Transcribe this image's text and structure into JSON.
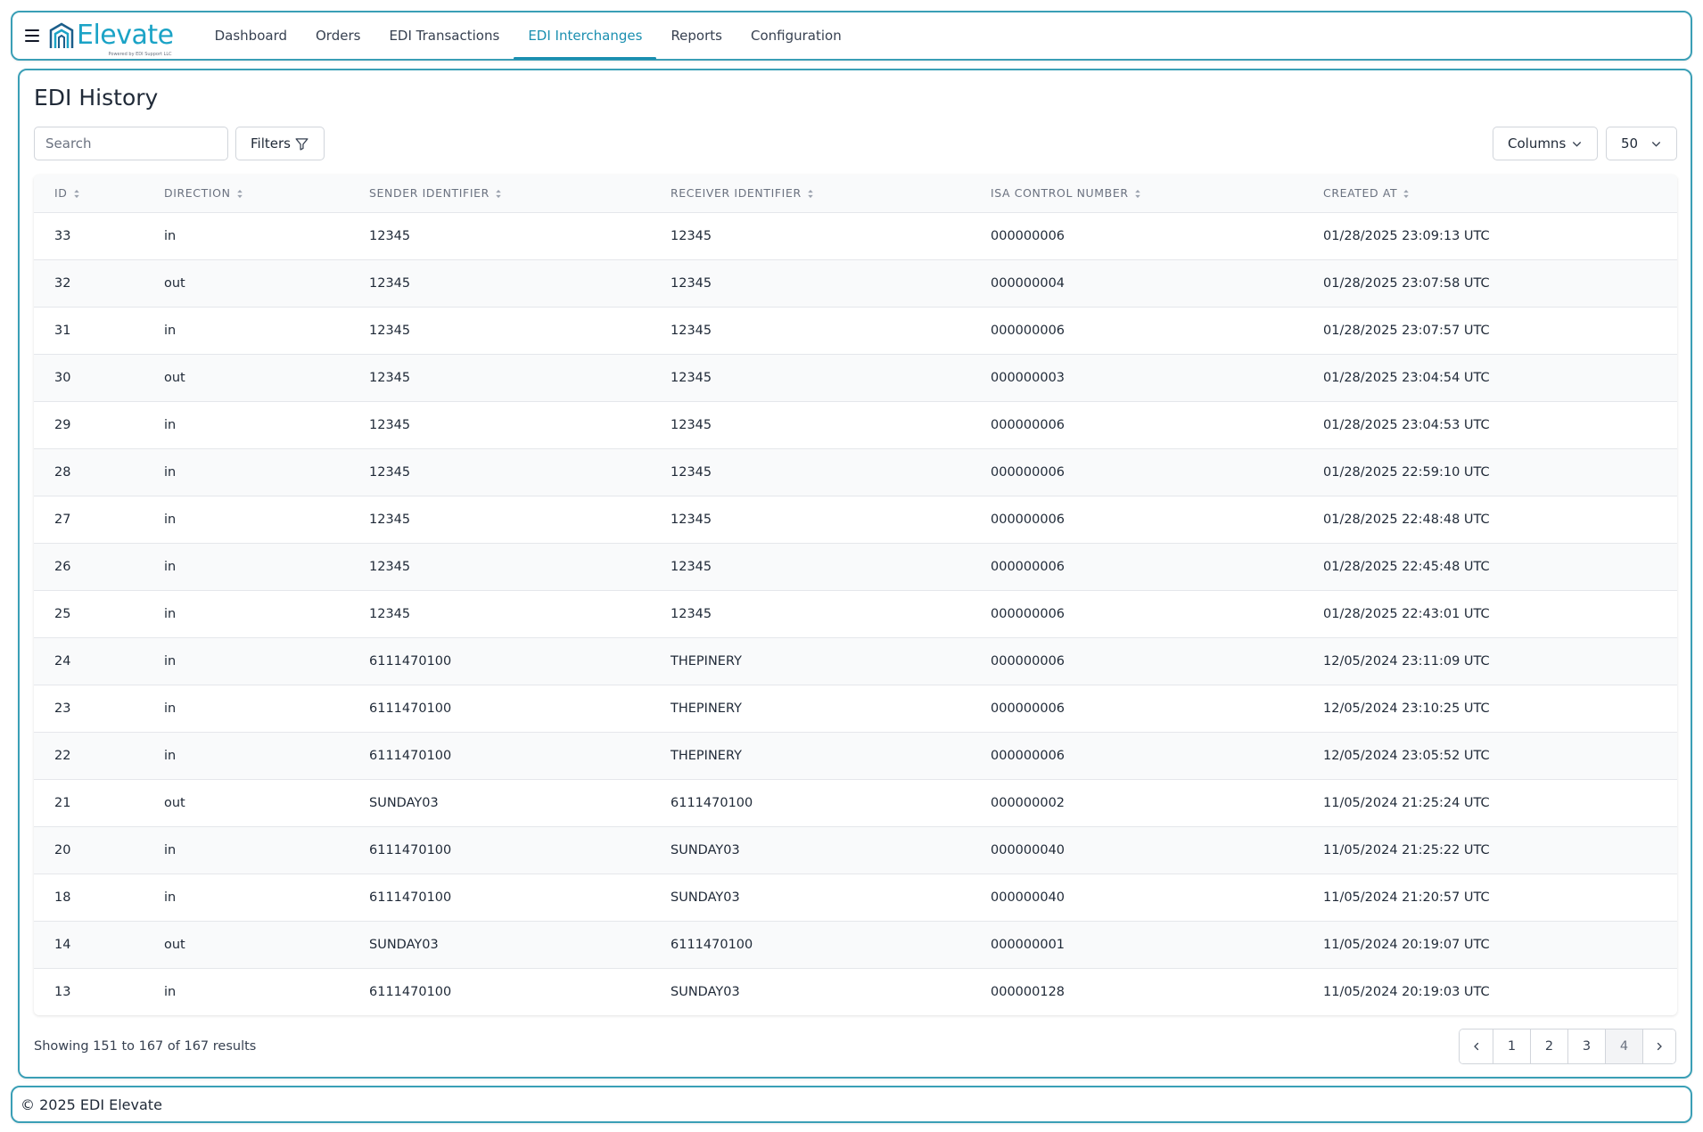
{
  "app": {
    "logo_text": "Elevate",
    "logo_subtext": "Powered by EDI Support LLC"
  },
  "nav": {
    "items": [
      {
        "label": "Dashboard",
        "active": false
      },
      {
        "label": "Orders",
        "active": false
      },
      {
        "label": "EDI Transactions",
        "active": false
      },
      {
        "label": "EDI Interchanges",
        "active": true
      },
      {
        "label": "Reports",
        "active": false
      },
      {
        "label": "Configuration",
        "active": false
      }
    ]
  },
  "page": {
    "title": "EDI History"
  },
  "toolbar": {
    "search_placeholder": "Search",
    "search_value": "",
    "filters_label": "Filters",
    "columns_label": "Columns",
    "per_page_value": "50"
  },
  "table": {
    "columns": [
      "ID",
      "DIRECTION",
      "SENDER IDENTIFIER",
      "RECEIVER IDENTIFIER",
      "ISA CONTROL NUMBER",
      "CREATED AT"
    ],
    "rows": [
      [
        "33",
        "in",
        "12345",
        "12345",
        "000000006",
        "01/28/2025 23:09:13 UTC"
      ],
      [
        "32",
        "out",
        "12345",
        "12345",
        "000000004",
        "01/28/2025 23:07:58 UTC"
      ],
      [
        "31",
        "in",
        "12345",
        "12345",
        "000000006",
        "01/28/2025 23:07:57 UTC"
      ],
      [
        "30",
        "out",
        "12345",
        "12345",
        "000000003",
        "01/28/2025 23:04:54 UTC"
      ],
      [
        "29",
        "in",
        "12345",
        "12345",
        "000000006",
        "01/28/2025 23:04:53 UTC"
      ],
      [
        "28",
        "in",
        "12345",
        "12345",
        "000000006",
        "01/28/2025 22:59:10 UTC"
      ],
      [
        "27",
        "in",
        "12345",
        "12345",
        "000000006",
        "01/28/2025 22:48:48 UTC"
      ],
      [
        "26",
        "in",
        "12345",
        "12345",
        "000000006",
        "01/28/2025 22:45:48 UTC"
      ],
      [
        "25",
        "in",
        "12345",
        "12345",
        "000000006",
        "01/28/2025 22:43:01 UTC"
      ],
      [
        "24",
        "in",
        "6111470100",
        "THEPINERY",
        "000000006",
        "12/05/2024 23:11:09 UTC"
      ],
      [
        "23",
        "in",
        "6111470100",
        "THEPINERY",
        "000000006",
        "12/05/2024 23:10:25 UTC"
      ],
      [
        "22",
        "in",
        "6111470100",
        "THEPINERY",
        "000000006",
        "12/05/2024 23:05:52 UTC"
      ],
      [
        "21",
        "out",
        "SUNDAY03",
        "6111470100",
        "000000002",
        "11/05/2024 21:25:24 UTC"
      ],
      [
        "20",
        "in",
        "6111470100",
        "SUNDAY03",
        "000000040",
        "11/05/2024 21:25:22 UTC"
      ],
      [
        "18",
        "in",
        "6111470100",
        "SUNDAY03",
        "000000040",
        "11/05/2024 21:20:57 UTC"
      ],
      [
        "14",
        "out",
        "SUNDAY03",
        "6111470100",
        "000000001",
        "11/05/2024 20:19:07 UTC"
      ],
      [
        "13",
        "in",
        "6111470100",
        "SUNDAY03",
        "000000128",
        "11/05/2024 20:19:03 UTC"
      ]
    ]
  },
  "pagination": {
    "summary": "Showing 151 to 167 of 167 results",
    "pages": [
      "1",
      "2",
      "3",
      "4"
    ],
    "current_page": "4"
  },
  "footer": {
    "text": "© 2025 EDI Elevate"
  },
  "colors": {
    "brand": "#1ba3c6",
    "accent_border": "#3a9fb6",
    "active_nav": "#1b8fb0"
  }
}
